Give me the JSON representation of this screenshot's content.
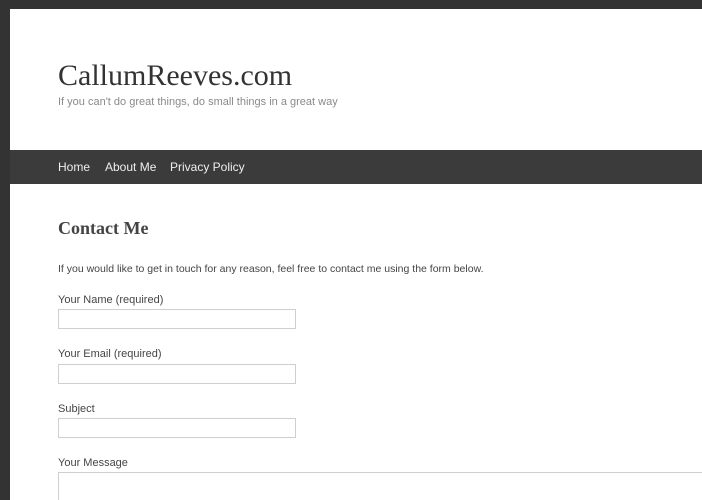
{
  "site": {
    "title": "CallumReeves.com",
    "tagline": "If you can't do great things, do small things in a great way"
  },
  "nav": {
    "items": [
      "Home",
      "About Me",
      "Privacy Policy"
    ]
  },
  "content": {
    "heading": "Contact Me",
    "intro": "If you would like to get in touch for any reason, feel free to contact me using the form below."
  },
  "form": {
    "name_label": "Your Name (required)",
    "name_value": "",
    "email_label": "Your Email (required)",
    "email_value": "",
    "subject_label": "Subject",
    "subject_value": "",
    "message_label": "Your Message",
    "message_value": ""
  },
  "colors": {
    "frame": "#333333",
    "navbar": "#3b3b3b",
    "page_background": "#ffffff"
  }
}
